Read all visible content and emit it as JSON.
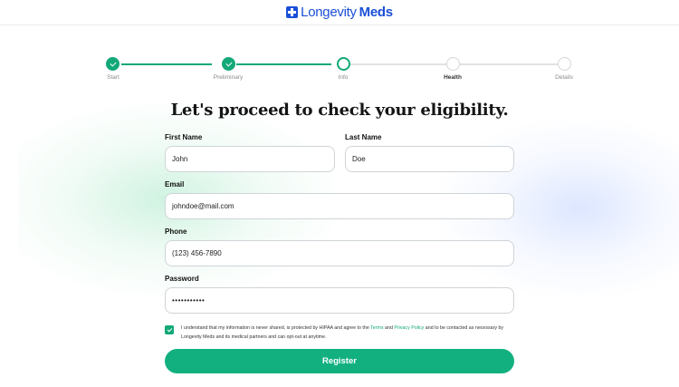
{
  "brand": {
    "name_part1": "Longevity",
    "name_part2": "Meds",
    "color": "#1a4fd6"
  },
  "accent_color": "#12a878",
  "stepper": {
    "steps": [
      {
        "label": "Start",
        "state": "done"
      },
      {
        "label": "Preliminary",
        "state": "done"
      },
      {
        "label": "Info",
        "state": "current"
      },
      {
        "label": "Health",
        "state": "todo"
      },
      {
        "label": "Details",
        "state": "todo"
      }
    ]
  },
  "form": {
    "title": "Let's proceed to check your eligibility.",
    "first_name": {
      "label": "First Name",
      "value": "John"
    },
    "last_name": {
      "label": "Last Name",
      "value": "Doe"
    },
    "email": {
      "label": "Email",
      "value": "johndoe@mail.com"
    },
    "phone": {
      "label": "Phone",
      "value": "(123) 456-7890"
    },
    "password": {
      "label": "Password",
      "value": "•••••••••••"
    },
    "consent": {
      "checked": true,
      "text_before": "I understand that my information is never shared, is protected by HIPAA and agree to the ",
      "terms_link": "Terms",
      "and": " and ",
      "privacy_link": "Privacy Policy",
      "text_after": " and to be contacted as necessary by Longevity Meds and its medical partners and can opt-out at anytime."
    },
    "register_label": "Register"
  }
}
